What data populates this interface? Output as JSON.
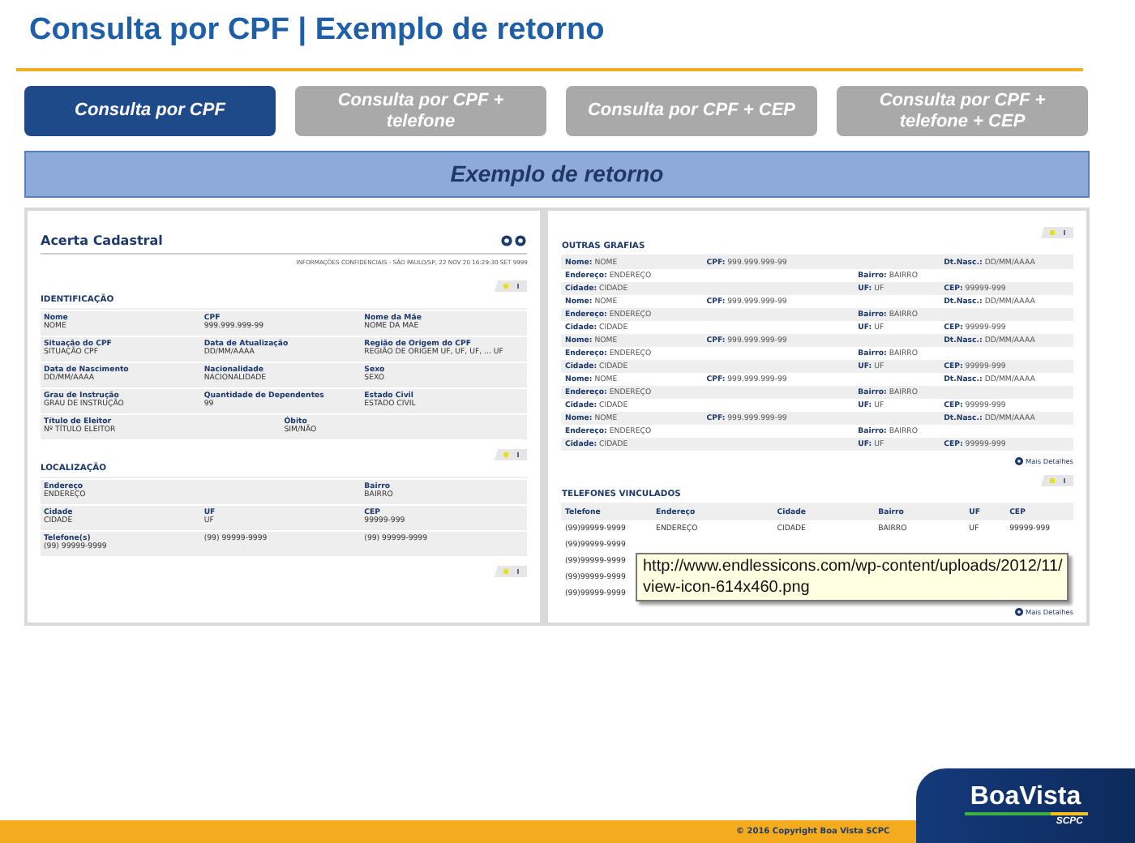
{
  "title": "Consulta por CPF | Exemplo de retorno",
  "tabs": [
    {
      "label": "Consulta por CPF",
      "selected": true
    },
    {
      "label": "Consulta por CPF + telefone",
      "selected": false
    },
    {
      "label": "Consulta por CPF + CEP",
      "selected": false
    },
    {
      "label": "Consulta por CPF + telefone + CEP",
      "selected": false
    }
  ],
  "banner": "Exemplo de retorno",
  "left_panel": {
    "title": "Acerta Cadastral",
    "info": "INFORMAÇÕES CONFIDENCIAIS - SÃO PAULO/SP, 22 NOV 20 16:29:30 SET 9999",
    "sections": [
      {
        "title": "IDENTIFICAÇÃO",
        "rows": [
          [
            {
              "label": "Nome",
              "value": "NOME"
            },
            {
              "label": "CPF",
              "value": "999.999.999-99"
            },
            {
              "label": "Nome da Mãe",
              "value": "NOME DA MAE"
            }
          ],
          [
            {
              "label": "Situação do CPF",
              "value": "SITUAÇÃO CPF"
            },
            {
              "label": "Data de Atualização",
              "value": "DD/MM/AAAA"
            },
            {
              "label": "Região de Origem do CPF",
              "value": "REGIÃO DE ORIGEM UF, UF, UF, ... UF"
            }
          ],
          [
            {
              "label": "Data de Nascimento",
              "value": "DD/MM/AAAA"
            },
            {
              "label": "Nacionalidade",
              "value": "NACIONALIDADE"
            },
            {
              "label": "Sexo",
              "value": "SEXO"
            }
          ],
          [
            {
              "label": "Grau de Instrução",
              "value": "GRAU DE INSTRUÇÃO"
            },
            {
              "label": "Quantidade de Dependentes",
              "value": "99"
            },
            {
              "label": "Estado Civil",
              "value": "ESTADO CIVIL"
            }
          ],
          [
            {
              "label": "Título de Eleitor",
              "value": "Nº TÍTULO ELEITOR"
            },
            {
              "label": "Óbito",
              "value": "SIM/NÃO"
            }
          ]
        ]
      },
      {
        "title": "LOCALIZAÇÃO",
        "rows": [
          [
            {
              "label": "Endereço",
              "value": "ENDEREÇO"
            },
            {},
            {
              "label": "Bairro",
              "value": "BAIRRO"
            }
          ],
          [
            {
              "label": "Cidade",
              "value": "CIDADE"
            },
            {
              "label": "UF",
              "value": "UF"
            },
            {
              "label": "CEP",
              "value": "99999-999"
            }
          ],
          [
            {
              "label": "Telefone(s)",
              "value": "(99) 99999-9999"
            },
            {
              "value": "(99) 99999-9999"
            },
            {
              "value": "(99) 99999-9999"
            }
          ]
        ]
      }
    ]
  },
  "right_panel": {
    "grafias_title": "OUTRAS GRAFIAS",
    "grafias": [
      {
        "nome": "**Nome:** NOME",
        "cpf": "**CPF:** 999.999.999-99",
        "nasc": "**Dt.Nasc.:** DD/MM/AAAA",
        "endereco": "**Endereço:** ENDEREÇO",
        "bairro": "**Bairro:** BAIRRO",
        "cidade": "**Cidade:** CIDADE",
        "uf": "**UF:** UF",
        "cep": "**CEP:** 99999-999"
      },
      {
        "nome": "**Nome:** NOME",
        "cpf": "**CPF:** 999.999.999-99",
        "nasc": "**Dt.Nasc.:** DD/MM/AAAA",
        "endereco": "**Endereço:** ENDEREÇO",
        "bairro": "**Bairro:** BAIRRO",
        "cidade": "**Cidade:** CIDADE",
        "uf": "**UF:** UF",
        "cep": "**CEP:** 99999-999"
      },
      {
        "nome": "**Nome:** NOME",
        "cpf": "**CPF:** 999.999.999-99",
        "nasc": "**Dt.Nasc.:** DD/MM/AAAA",
        "endereco": "**Endereço:** ENDEREÇO",
        "bairro": "**Bairro:** BAIRRO",
        "cidade": "**Cidade:** CIDADE",
        "uf": "**UF:** UF",
        "cep": "**CEP:** 99999-999"
      },
      {
        "nome": "**Nome:** NOME",
        "cpf": "**CPF:** 999.999.999-99",
        "nasc": "**Dt.Nasc.:** DD/MM/AAAA",
        "endereco": "**Endereço:** ENDEREÇO",
        "bairro": "**Bairro:** BAIRRO",
        "cidade": "**Cidade:** CIDADE",
        "uf": "**UF:** UF",
        "cep": "**CEP:** 99999-999"
      },
      {
        "nome": "**Nome:** NOME",
        "cpf": "**CPF:** 999.999.999-99",
        "nasc": "**Dt.Nasc.:** DD/MM/AAAA",
        "endereco": "**Endereço:** ENDEREÇO",
        "bairro": "**Bairro:** BAIRRO",
        "cidade": "**Cidade:** CIDADE",
        "uf": "**UF:** UF",
        "cep": "**CEP:** 99999-999"
      }
    ],
    "more_link": "Mais Detalhes",
    "phones_title": "TELEFONES VINCULADOS",
    "phones_columns": [
      "Telefone",
      "Endereço",
      "Cidade",
      "Bairro",
      "UF",
      "CEP"
    ],
    "phones_rows": [
      [
        "(99)99999-9999",
        "ENDEREÇO",
        "CIDADE",
        "BAIRRO",
        "UF",
        "99999-999"
      ],
      [
        "(99)99999-9999"
      ],
      [
        "(99)99999-9999"
      ],
      [
        "(99)99999-9999"
      ],
      [
        "(99)99999-9999"
      ]
    ],
    "more_link_2": "Mais Detalhes"
  },
  "tooltip": [
    "http://www.endlessicons.com/wp-content/uploads/2012/11/",
    "view-icon-614x460.png"
  ],
  "footer": {
    "copyright": "© 2016 Copyright Boa Vista SCPC",
    "logo": "BoaVista",
    "logo_sub": "SCPC"
  }
}
